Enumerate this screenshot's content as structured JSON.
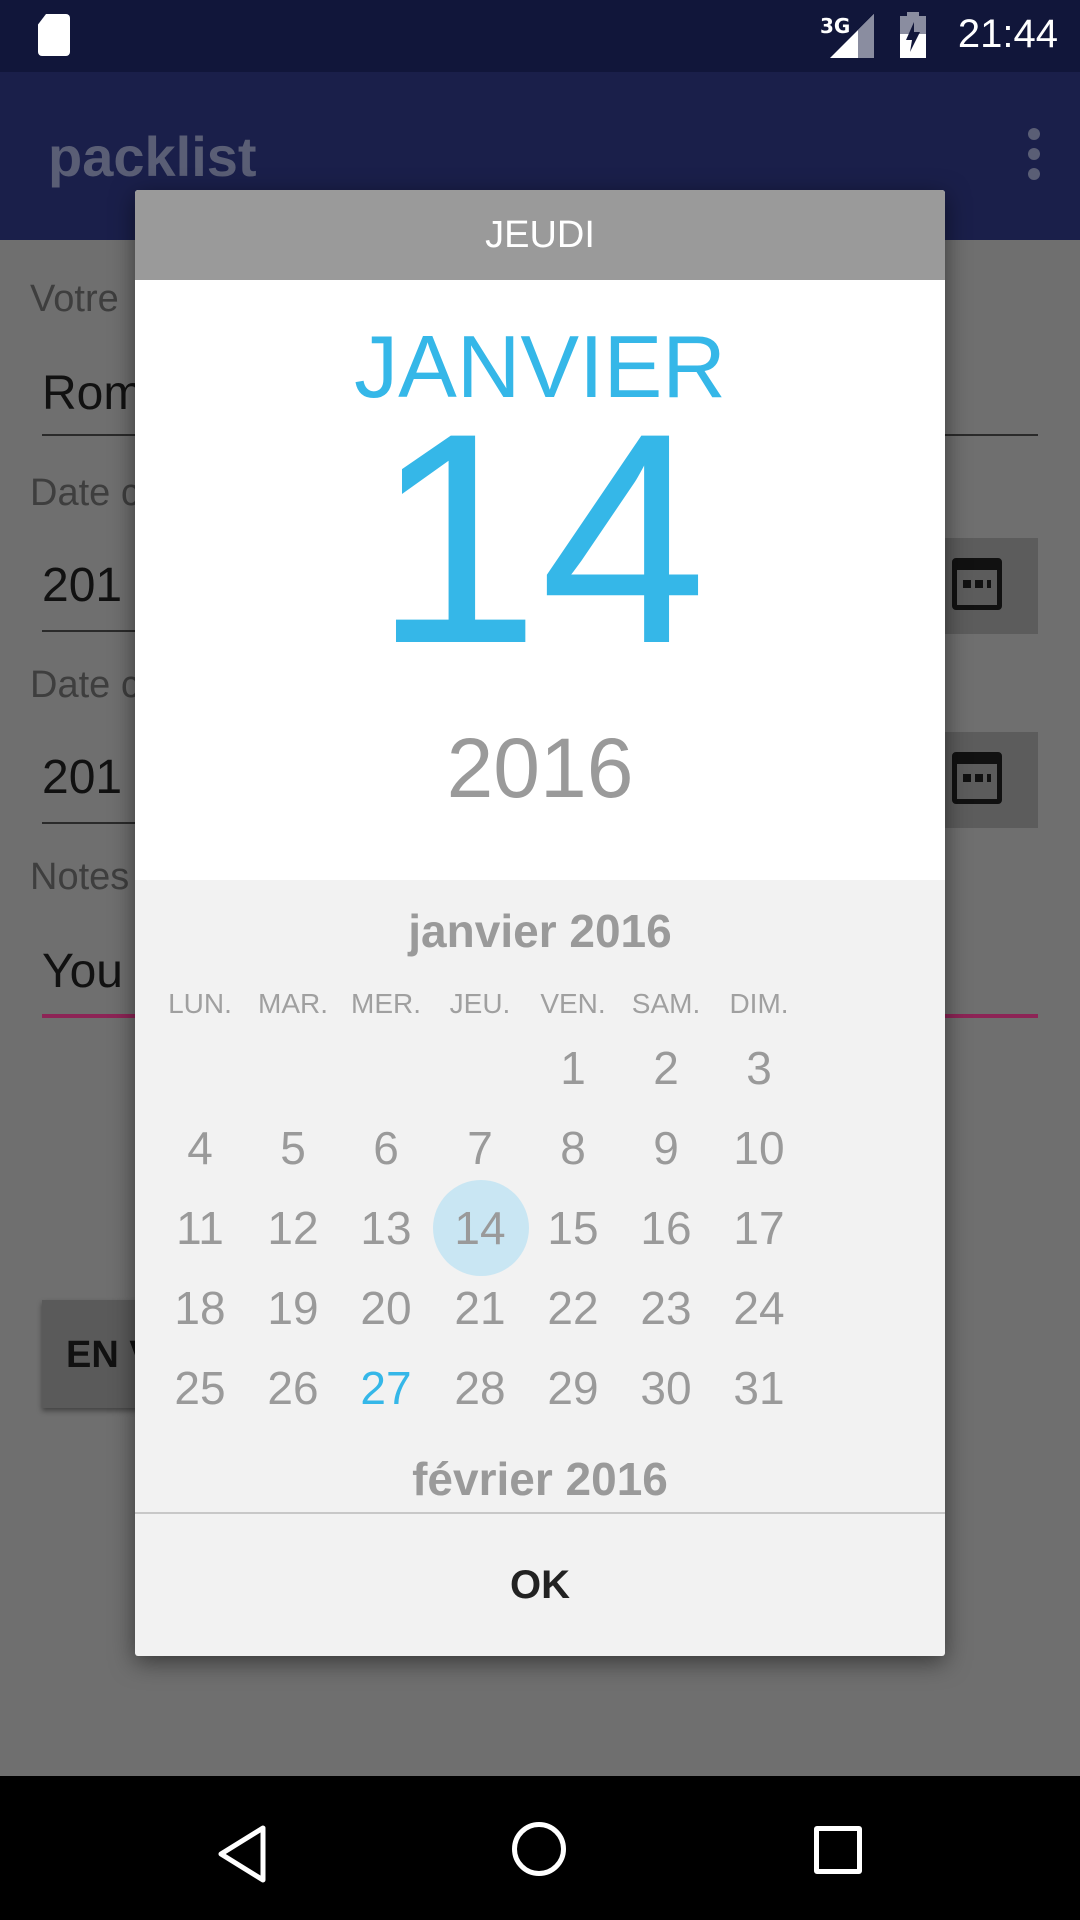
{
  "status_bar": {
    "network": "3G",
    "time": "21:44"
  },
  "app_bar": {
    "title": "packlist"
  },
  "form": {
    "name_label": "Votre",
    "name_value": "Rom",
    "date1_label": "Date c",
    "date1_value": "201",
    "date2_label": "Date c",
    "date2_value": "201",
    "notes_label": "Notes",
    "notes_value": "You",
    "send_label": "EN V",
    "accent_color": "#c2185b"
  },
  "dialog": {
    "weekday": "JEUDI",
    "month": "JANVIER",
    "day": "14",
    "year": "2016",
    "calendar_title": "janvier 2016",
    "next_month_title": "février 2016",
    "weekdays": [
      "LUN.",
      "MAR.",
      "MER.",
      "JEU.",
      "VEN.",
      "SAM.",
      "DIM."
    ],
    "weeks": [
      [
        "",
        "",
        "",
        "",
        "1",
        "2",
        "3"
      ],
      [
        "4",
        "5",
        "6",
        "7",
        "8",
        "9",
        "10"
      ],
      [
        "11",
        "12",
        "13",
        "14",
        "15",
        "16",
        "17"
      ],
      [
        "18",
        "19",
        "20",
        "21",
        "22",
        "23",
        "24"
      ],
      [
        "25",
        "26",
        "27",
        "28",
        "29",
        "30",
        "31"
      ]
    ],
    "selected_day": "14",
    "today": "27",
    "ok_label": "OK",
    "accent_color": "#35b7e8"
  },
  "nav_bar": {
    "icons": [
      "back-icon",
      "home-icon",
      "recent-apps-icon"
    ]
  }
}
